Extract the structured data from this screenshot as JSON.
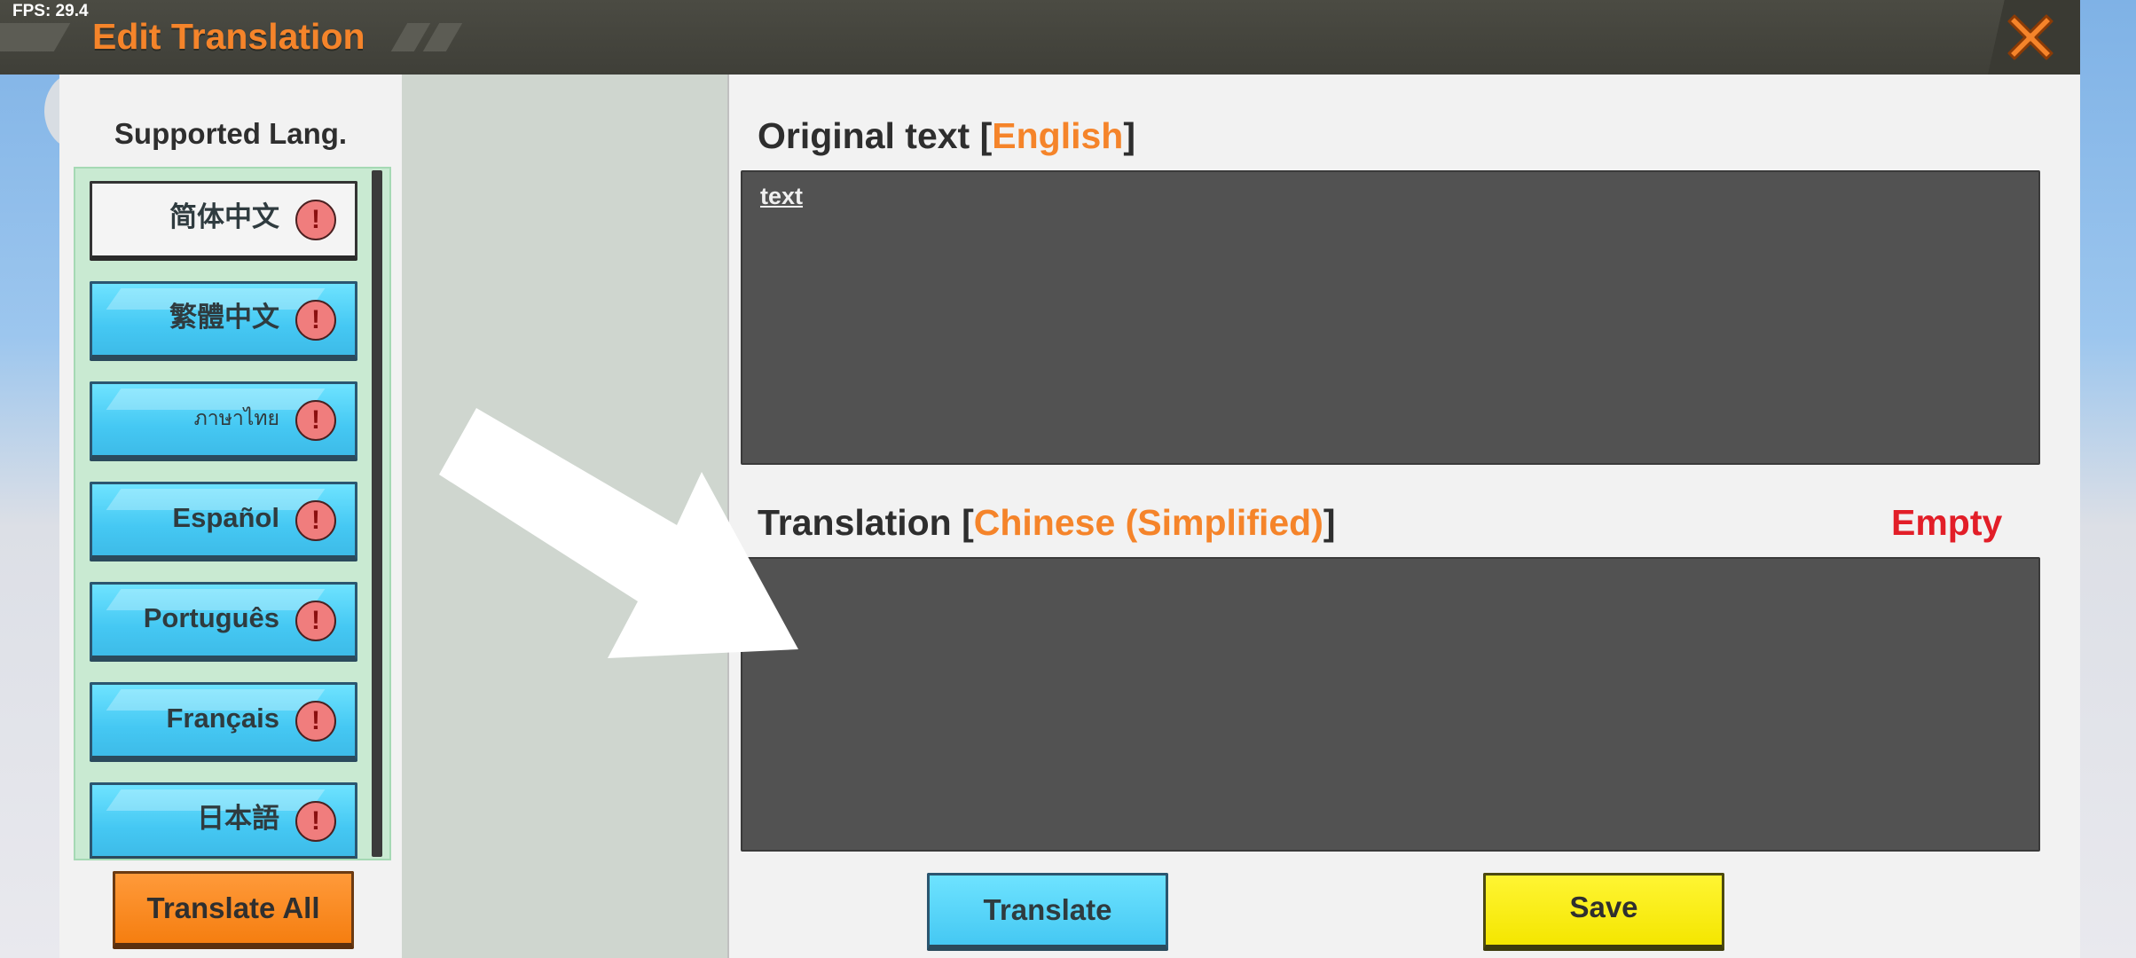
{
  "fps": "FPS: 29.4",
  "header": {
    "title": "Edit Translation",
    "close_icon": "close-icon",
    "accent": "#f5842a"
  },
  "sidebar": {
    "title": "Supported Lang.",
    "languages": [
      {
        "label": "简体中文",
        "selected": true,
        "status_icon": "alert-icon"
      },
      {
        "label": "繁體中文",
        "selected": false,
        "status_icon": "alert-icon"
      },
      {
        "label": "ภาษาไทย",
        "selected": false,
        "status_icon": "alert-icon"
      },
      {
        "label": "Español",
        "selected": false,
        "status_icon": "alert-icon"
      },
      {
        "label": "Português",
        "selected": false,
        "status_icon": "alert-icon"
      },
      {
        "label": "Français",
        "selected": false,
        "status_icon": "alert-icon"
      },
      {
        "label": "日本語",
        "selected": false,
        "status_icon": "alert-icon"
      }
    ],
    "alert_glyph": "!",
    "translate_all_label": "Translate All"
  },
  "original": {
    "title_prefix": "Original text [",
    "language": "English",
    "title_suffix": "]",
    "text": "text"
  },
  "translation": {
    "title_prefix": "Translation [",
    "language": "Chinese (Simplified)",
    "title_suffix": "]",
    "status": "Empty",
    "text": ""
  },
  "actions": {
    "translate_label": "Translate",
    "save_label": "Save"
  },
  "colors": {
    "blue_button": "#45c8f3",
    "orange_button": "#f57e10",
    "yellow_button": "#f4e600",
    "status_red": "#e21e28"
  }
}
